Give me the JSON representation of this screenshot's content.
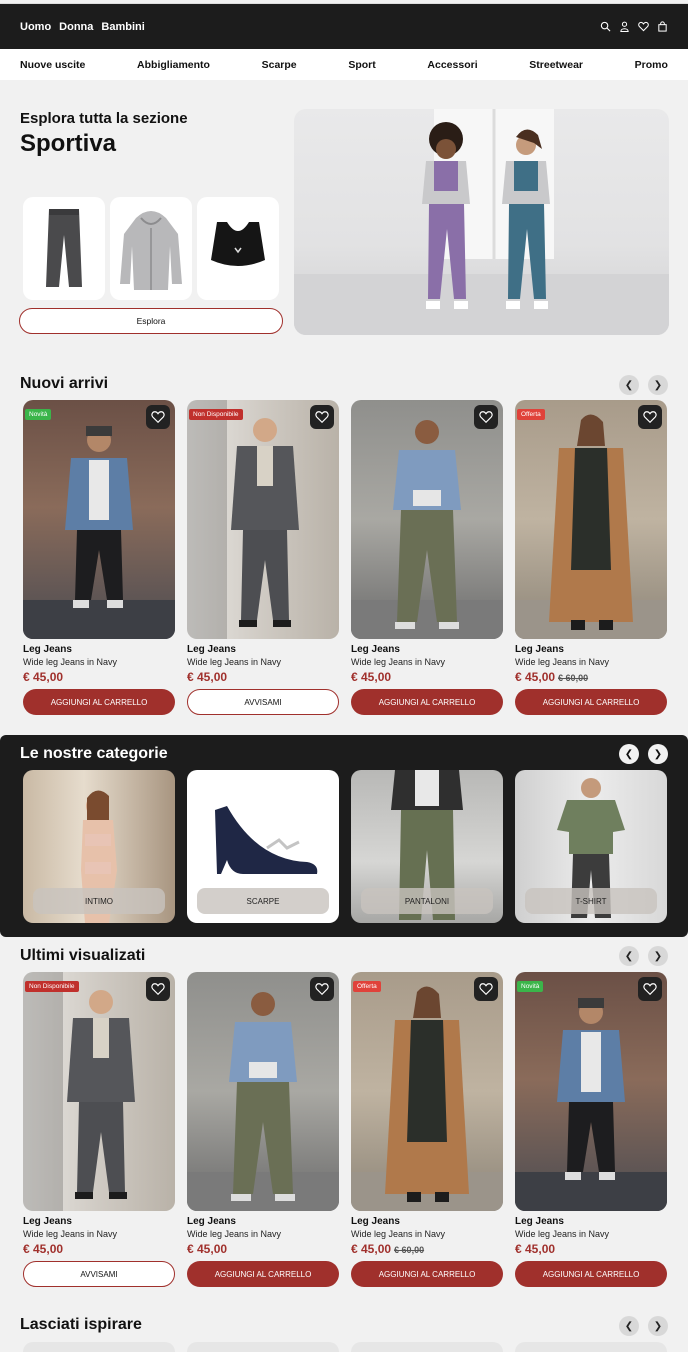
{
  "topnav": {
    "links": [
      "Uomo",
      "Donna",
      "Bambini"
    ],
    "icons": [
      "search-icon",
      "user-icon",
      "heart-icon",
      "bag-icon"
    ]
  },
  "categories_bar": [
    "Nuove uscite",
    "Abbigliamento",
    "Scarpe",
    "Sport",
    "Accessori",
    "Streetwear",
    "Promo"
  ],
  "hero": {
    "title": "Esplora tutta la sezione",
    "big": "Sportiva",
    "button": "Esplora"
  },
  "new_arrivals": {
    "title": "Nuovi arrivi",
    "products": [
      {
        "badge": "Novità",
        "badge_color": "#3bb54a",
        "name": "Leg Jeans",
        "desc": "Wide leg Jeans in Navy",
        "price": "€ 45,00",
        "old": "",
        "button": "AGGIUNGI AL CARRELLO",
        "button_type": "cart"
      },
      {
        "badge": "Non Disponibile",
        "badge_color": "#c0302c",
        "name": "Leg Jeans",
        "desc": "Wide leg Jeans in Navy",
        "price": "€ 45,00",
        "old": "",
        "button": "AVVISAMI",
        "button_type": "notify"
      },
      {
        "badge": "",
        "badge_color": "",
        "name": "Leg Jeans",
        "desc": "Wide leg Jeans in Navy",
        "price": "€ 45,00",
        "old": "",
        "button": "AGGIUNGI AL CARRELLO",
        "button_type": "cart"
      },
      {
        "badge": "Offerta",
        "badge_color": "#e0423a",
        "name": "Leg Jeans",
        "desc": "Wide leg Jeans in Navy",
        "price": "€ 45,00",
        "old": "€ 60,00",
        "button": "AGGIUNGI AL CARRELLO",
        "button_type": "cart"
      }
    ]
  },
  "our_categories": {
    "title": "Le nostre categorie",
    "items": [
      "INTIMO",
      "SCARPE",
      "PANTALONI",
      "T-SHIRT"
    ]
  },
  "recently_viewed": {
    "title": "Ultimi visualizati",
    "products": [
      {
        "badge": "Non Disponibile",
        "badge_color": "#c0302c",
        "name": "Leg Jeans",
        "desc": "Wide leg Jeans in Navy",
        "price": "€ 45,00",
        "old": "",
        "button": "AVVISAMI",
        "button_type": "notify"
      },
      {
        "badge": "",
        "badge_color": "",
        "name": "Leg Jeans",
        "desc": "Wide leg Jeans in Navy",
        "price": "€ 45,00",
        "old": "",
        "button": "AGGIUNGI AL CARRELLO",
        "button_type": "cart"
      },
      {
        "badge": "Offerta",
        "badge_color": "#e0423a",
        "name": "Leg Jeans",
        "desc": "Wide leg Jeans in Navy",
        "price": "€ 45,00",
        "old": "€ 60,00",
        "button": "AGGIUNGI AL CARRELLO",
        "button_type": "cart"
      },
      {
        "badge": "Novità",
        "badge_color": "#3bb54a",
        "name": "Leg Jeans",
        "desc": "Wide leg Jeans in Navy",
        "price": "€ 45,00",
        "old": "",
        "button": "AGGIUNGI AL CARRELLO",
        "button_type": "cart"
      }
    ]
  },
  "inspire": {
    "title": "Lasciati ispirare"
  },
  "colors": {
    "accent": "#a0302c",
    "dark": "#1c1c1c"
  }
}
